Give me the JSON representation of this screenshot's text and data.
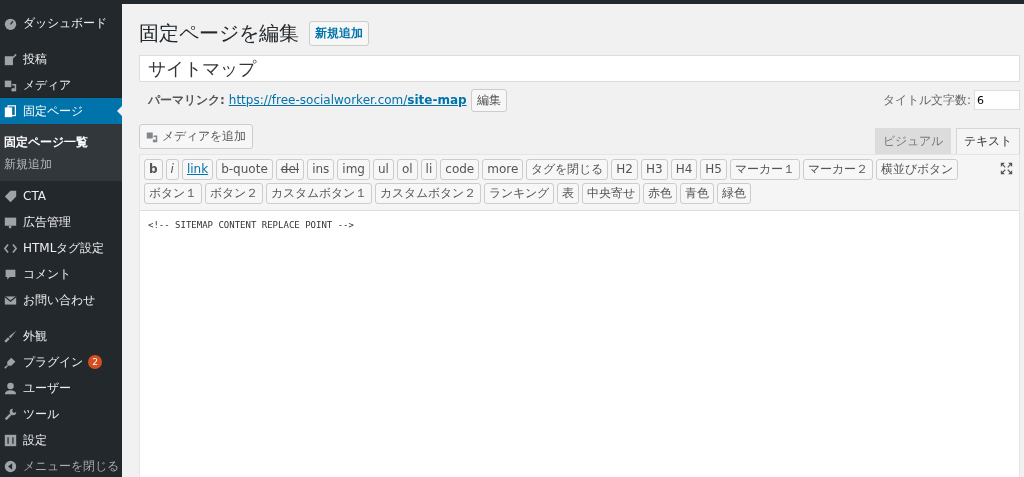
{
  "sidebar": {
    "groups": [
      [
        {
          "label": "ダッシュボード",
          "selected": false
        }
      ],
      [
        {
          "label": "投稿",
          "selected": false
        },
        {
          "label": "メディア",
          "selected": false
        },
        {
          "label": "固定ページ",
          "selected": true,
          "submenu": [
            {
              "label": "固定ページ一覧",
              "selected": true
            },
            {
              "label": "新規追加",
              "selected": false
            }
          ]
        },
        {
          "label": "CTA",
          "selected": false
        },
        {
          "label": "広告管理",
          "selected": false
        },
        {
          "label": "HTMLタグ設定",
          "selected": false
        },
        {
          "label": "コメント",
          "selected": false
        },
        {
          "label": "お問い合わせ",
          "selected": false
        }
      ],
      [
        {
          "label": "外観",
          "selected": false
        },
        {
          "label": "プラグイン",
          "selected": false,
          "badge": "2"
        },
        {
          "label": "ユーザー",
          "selected": false
        },
        {
          "label": "ツール",
          "selected": false
        },
        {
          "label": "設定",
          "selected": false
        },
        {
          "label": "メニューを閉じる",
          "selected": false,
          "kind": "collapse"
        }
      ]
    ]
  },
  "heading": {
    "title": "固定ページを編集",
    "add_new": "新規追加"
  },
  "title_field": {
    "value": "サイトマップ"
  },
  "permalink": {
    "label": "パーマリンク:",
    "url_base": "https://free-socialworker.com/",
    "slug": "site-map",
    "edit": "編集"
  },
  "title_count": {
    "label": "タイトル文字数:",
    "value": "6"
  },
  "add_media": "メディアを追加",
  "editor_tabs": [
    {
      "label": "ビジュアル",
      "selected": false
    },
    {
      "label": "テキスト",
      "selected": true
    }
  ],
  "quicktags": [
    {
      "label": "b",
      "kind": "bold"
    },
    {
      "label": "i",
      "kind": "italic"
    },
    {
      "label": "link",
      "kind": "underline"
    },
    {
      "label": "b-quote",
      "kind": "plain"
    },
    {
      "label": "del",
      "kind": "strike"
    },
    {
      "label": "ins",
      "kind": "plain"
    },
    {
      "label": "img",
      "kind": "plain"
    },
    {
      "label": "ul",
      "kind": "plain"
    },
    {
      "label": "ol",
      "kind": "plain"
    },
    {
      "label": "li",
      "kind": "plain"
    },
    {
      "label": "code",
      "kind": "plain"
    },
    {
      "label": "more",
      "kind": "plain"
    },
    {
      "label": "タグを閉じる",
      "kind": "plain"
    },
    {
      "label": "H2",
      "kind": "plain"
    },
    {
      "label": "H3",
      "kind": "plain"
    },
    {
      "label": "H4",
      "kind": "plain"
    },
    {
      "label": "H5",
      "kind": "plain"
    },
    {
      "label": "マーカー１",
      "kind": "plain"
    },
    {
      "label": "マーカー２",
      "kind": "plain"
    },
    {
      "label": "横並びボタン",
      "kind": "plain"
    },
    {
      "label": "ボタン１",
      "kind": "plain"
    },
    {
      "label": "ボタン２",
      "kind": "plain"
    },
    {
      "label": "カスタムボタン１",
      "kind": "plain"
    },
    {
      "label": "カスタムボタン２",
      "kind": "plain"
    },
    {
      "label": "ランキング",
      "kind": "plain"
    },
    {
      "label": "表",
      "kind": "plain"
    },
    {
      "label": "中央寄せ",
      "kind": "plain"
    },
    {
      "label": "赤色",
      "kind": "plain"
    },
    {
      "label": "青色",
      "kind": "plain"
    },
    {
      "label": "緑色",
      "kind": "plain"
    }
  ],
  "editor": {
    "value": "<!-- SITEMAP CONTENT REPLACE POINT -->"
  }
}
